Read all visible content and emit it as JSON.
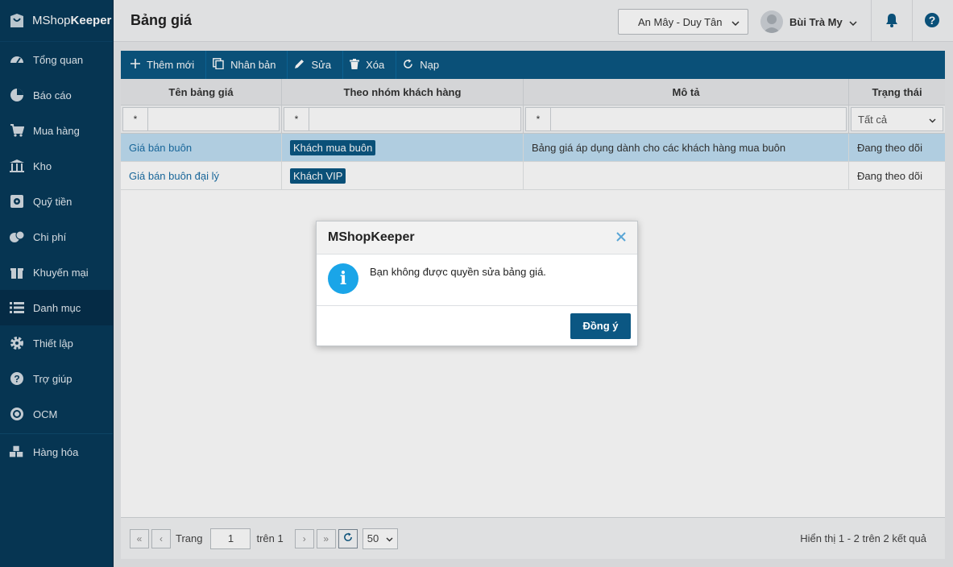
{
  "app": {
    "logo_plain": "MShop",
    "logo_bold": "Keeper"
  },
  "sidebar": {
    "items": [
      {
        "label": "Tổng quan",
        "icon": "dashboard-icon"
      },
      {
        "label": "Báo cáo",
        "icon": "pie-chart-icon"
      },
      {
        "label": "Mua hàng",
        "icon": "cart-icon"
      },
      {
        "label": "Kho",
        "icon": "warehouse-icon"
      },
      {
        "label": "Quỹ tiền",
        "icon": "safe-icon"
      },
      {
        "label": "Chi phí",
        "icon": "expense-icon"
      },
      {
        "label": "Khuyến mại",
        "icon": "gift-icon"
      },
      {
        "label": "Danh mục",
        "icon": "list-icon",
        "active": true
      },
      {
        "label": "Thiết lập",
        "icon": "gear-icon"
      },
      {
        "label": "Trợ giúp",
        "icon": "help-icon"
      },
      {
        "label": "OCM",
        "icon": "ocm-icon"
      },
      {
        "label": "Hàng hóa",
        "icon": "boxes-icon"
      }
    ]
  },
  "header": {
    "title": "Bảng giá",
    "store": "An Mây - Duy Tân",
    "user": "Bùi Trà My"
  },
  "toolbar": {
    "add": "Thêm mới",
    "duplicate": "Nhân bản",
    "edit": "Sửa",
    "delete": "Xóa",
    "reload": "Nạp"
  },
  "table": {
    "columns": [
      "Tên bảng giá",
      "Theo nhóm khách hàng",
      "Mô tả",
      "Trạng thái"
    ],
    "filter_op": "*",
    "status_filter": "Tất cả",
    "rows": [
      {
        "name": "Giá bán buôn",
        "group": "Khách mua buôn",
        "desc": "Bảng giá áp dụng dành cho các khách hàng mua buôn",
        "status": "Đang theo dõi"
      },
      {
        "name": "Giá bán buôn đại lý",
        "group": "Khách VIP",
        "desc": "",
        "status": "Đang theo dõi"
      }
    ]
  },
  "pager": {
    "page_label": "Trang",
    "page": "1",
    "of_label": "trên 1",
    "page_size": "50",
    "info": "Hiển thị 1 - 2 trên 2 kết quả"
  },
  "dialog": {
    "title": "MShopKeeper",
    "message": "Bạn không được quyền sửa bảng giá.",
    "ok": "Đồng ý"
  },
  "colors": {
    "sidebar": "#073a5a",
    "accent": "#0b5783",
    "info": "#1aa5e8",
    "selected_row": "#bfdff3"
  }
}
